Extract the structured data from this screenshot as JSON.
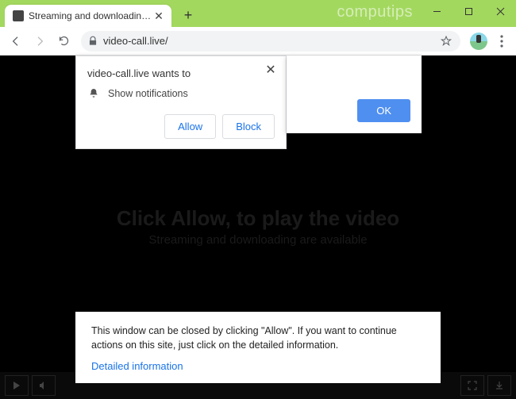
{
  "window": {
    "watermark": "computips"
  },
  "tab": {
    "title": "Streaming and downloading are"
  },
  "toolbar": {
    "url": "video-call.live/"
  },
  "notif": {
    "title": "video-call.live wants to",
    "permission": "Show notifications",
    "allow": "Allow",
    "block": "Block"
  },
  "dialog": {
    "ok": "OK"
  },
  "page": {
    "headline": "Click Allow, to play the video",
    "subline": "Streaming and downloading are available"
  },
  "panel": {
    "text": "This window can be closed by clicking \"Allow\". If you want to continue actions on this site, just click on the detailed information.",
    "link": "Detailed information"
  }
}
